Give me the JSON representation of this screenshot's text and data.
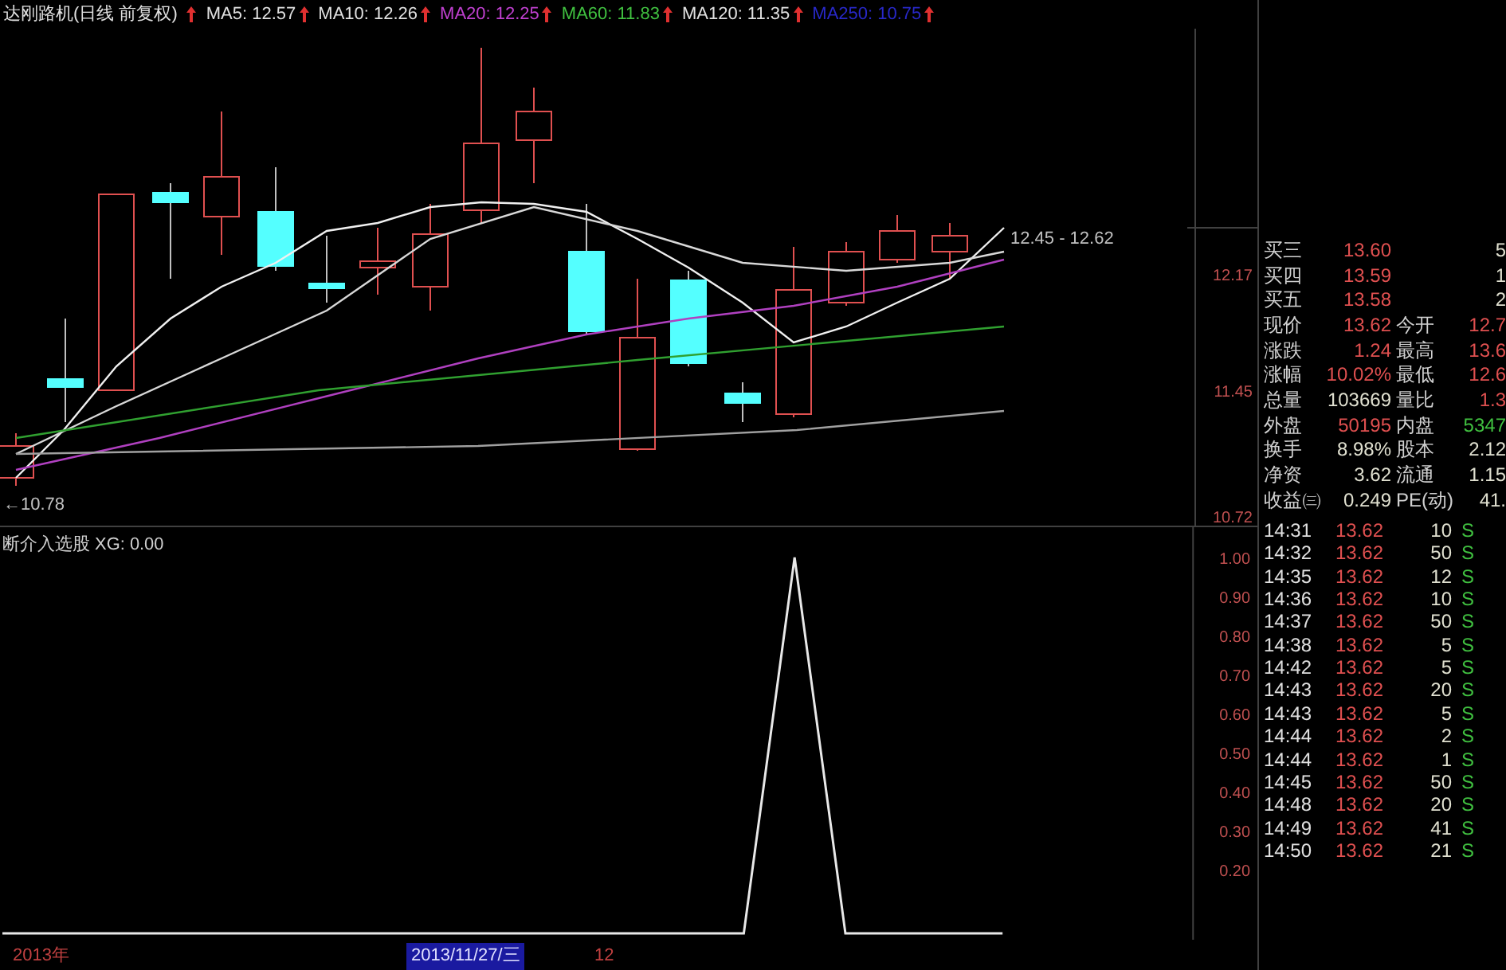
{
  "header": {
    "title": "达刚路机(日线 前复权)",
    "indicators": [
      {
        "label": "MA5: 12.57",
        "color": "#e0e0e0"
      },
      {
        "label": "MA10: 12.26",
        "color": "#e0e0e0"
      },
      {
        "label": "MA20: 12.25",
        "color": "#c040d0"
      },
      {
        "label": "MA60: 11.83",
        "color": "#40c040"
      },
      {
        "label": "MA120: 11.35",
        "color": "#e0e0e0"
      },
      {
        "label": "MA250: 10.75",
        "color": "#2828c8"
      }
    ]
  },
  "price_chart": {
    "range_label": "12.45 - 12.62",
    "low_label": "←10.78",
    "axis_labels": [
      "12.17",
      "11.45",
      "10.72"
    ]
  },
  "indicator_panel": {
    "title": "断介入选股 XG: 0.00",
    "axis_labels": [
      "1.00",
      "0.90",
      "0.80",
      "0.70",
      "0.60",
      "0.50",
      "0.40",
      "0.30",
      "0.20"
    ]
  },
  "time_axis": [
    {
      "label": "2013年",
      "selected": false
    },
    {
      "label": "2013/11/27/三",
      "selected": true
    },
    {
      "label": "12",
      "selected": false
    }
  ],
  "quote": {
    "bids": [
      {
        "label": "买三",
        "price": "13.60",
        "volume": "5"
      },
      {
        "label": "买四",
        "price": "13.59",
        "volume": "1"
      },
      {
        "label": "买五",
        "price": "13.58",
        "volume": "2"
      }
    ],
    "stats": [
      {
        "left": {
          "label": "现价",
          "value": "13.62",
          "color": "#e05050"
        },
        "right": {
          "label": "今开",
          "value": "12.7",
          "color": "#e05050"
        }
      },
      {
        "left": {
          "label": "涨跌",
          "value": "1.24",
          "color": "#e05050"
        },
        "right": {
          "label": "最高",
          "value": "13.6",
          "color": "#e05050"
        }
      },
      {
        "left": {
          "label": "涨幅",
          "value": "10.02%",
          "color": "#e05050"
        },
        "right": {
          "label": "最低",
          "value": "12.6",
          "color": "#e05050"
        }
      },
      {
        "left": {
          "label": "总量",
          "value": "103669",
          "color": "#e0e0d0"
        },
        "right": {
          "label": "量比",
          "value": "1.3",
          "color": "#e05050"
        }
      },
      {
        "left": {
          "label": "外盘",
          "value": "50195",
          "color": "#e05050"
        },
        "right": {
          "label": "内盘",
          "value": "5347",
          "color": "#40c040"
        }
      },
      {
        "left": {
          "label": "换手",
          "value": "8.98%",
          "color": "#e0e0d0"
        },
        "right": {
          "label": "股本",
          "value": "2.12",
          "color": "#e0e0d0"
        }
      },
      {
        "left": {
          "label": "净资",
          "value": "3.62",
          "color": "#e0e0d0"
        },
        "right": {
          "label": "流通",
          "value": "1.15",
          "color": "#e0e0d0"
        }
      },
      {
        "left": {
          "label": "收益㈢",
          "value": "0.249",
          "color": "#e0e0d0"
        },
        "right": {
          "label": "PE(动)",
          "value": "41.",
          "color": "#e0e0d0"
        }
      }
    ]
  },
  "trades": [
    {
      "time": "14:31",
      "price": "13.62",
      "volume": "10",
      "side": "S"
    },
    {
      "time": "14:32",
      "price": "13.62",
      "volume": "50",
      "side": "S"
    },
    {
      "time": "14:35",
      "price": "13.62",
      "volume": "12",
      "side": "S"
    },
    {
      "time": "14:36",
      "price": "13.62",
      "volume": "10",
      "side": "S"
    },
    {
      "time": "14:37",
      "price": "13.62",
      "volume": "50",
      "side": "S"
    },
    {
      "time": "14:38",
      "price": "13.62",
      "volume": "5",
      "side": "S"
    },
    {
      "time": "14:42",
      "price": "13.62",
      "volume": "5",
      "side": "S"
    },
    {
      "time": "14:43",
      "price": "13.62",
      "volume": "20",
      "side": "S"
    },
    {
      "time": "14:43",
      "price": "13.62",
      "volume": "5",
      "side": "S"
    },
    {
      "time": "14:44",
      "price": "13.62",
      "volume": "2",
      "side": "S"
    },
    {
      "time": "14:44",
      "price": "13.62",
      "volume": "1",
      "side": "S"
    },
    {
      "time": "14:45",
      "price": "13.62",
      "volume": "50",
      "side": "S"
    },
    {
      "time": "14:48",
      "price": "13.62",
      "volume": "20",
      "side": "S"
    },
    {
      "time": "14:49",
      "price": "13.62",
      "volume": "41",
      "side": "S"
    },
    {
      "time": "14:50",
      "price": "13.62",
      "volume": "21",
      "side": "S"
    }
  ]
}
